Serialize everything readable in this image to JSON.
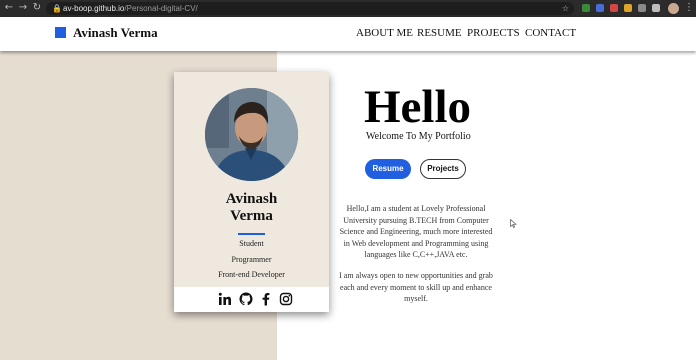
{
  "browser": {
    "url_host": "av-boop.github.io",
    "url_path": "/Personal-digital-CV/"
  },
  "site": {
    "brand_name": "Avinash Verma",
    "nav": [
      "ABOUT ME",
      "RESUME",
      "PROJECTS",
      "CONTACT"
    ]
  },
  "card": {
    "name_line1": "Avinash",
    "name_line2": "Verma",
    "roles": [
      "Student",
      "Programmer",
      "Front-end Developer"
    ],
    "social": [
      "linkedin-icon",
      "github-icon",
      "facebook-icon",
      "instagram-icon"
    ]
  },
  "hero": {
    "title": "Hello",
    "subtitle": "Welcome To My Portfolio",
    "resume_label": "Resume",
    "projects_label": "Projects",
    "bio1": "Hello,I am a student at Lovely Professional University pursuing B.TECH from Computer Science and Engineering, much more interested in Web development and Programming using languages like C,C++,JAVA etc.",
    "bio2": "I am always open to new opportunities and grab each and every moment to skill up and enhance myself."
  },
  "colors": {
    "accent": "#1f5fe0",
    "left_panel": "#e6ddd1",
    "card_bg": "#efe8de"
  }
}
